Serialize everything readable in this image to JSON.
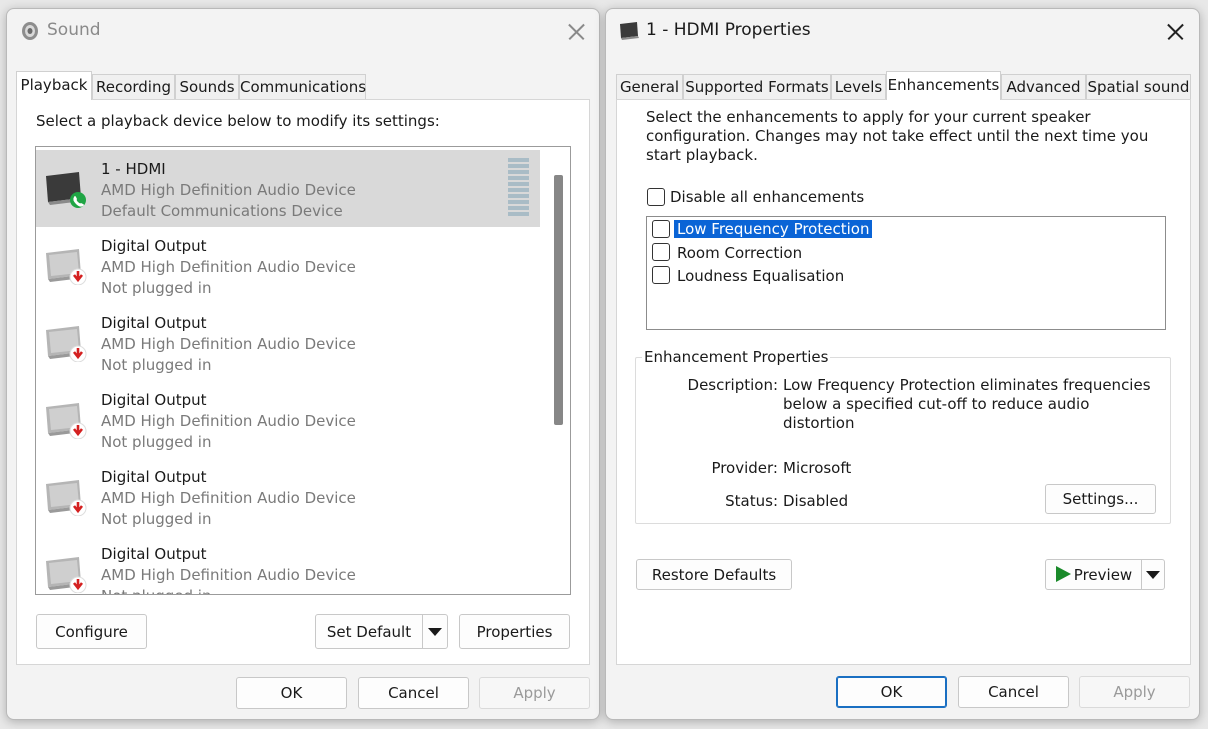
{
  "sound_window": {
    "title": "Sound",
    "tabs": [
      "Playback",
      "Recording",
      "Sounds",
      "Communications"
    ],
    "active_tab": "Playback",
    "instruction": "Select a playback device below to modify its settings:",
    "devices": [
      {
        "name": "1 - HDMI",
        "driver": "AMD High Definition Audio Device",
        "status": "Default Communications Device",
        "badge": "phone",
        "selected": true
      },
      {
        "name": "Digital Output",
        "driver": "AMD High Definition Audio Device",
        "status": "Not plugged in",
        "badge": "unplugged",
        "selected": false
      },
      {
        "name": "Digital Output",
        "driver": "AMD High Definition Audio Device",
        "status": "Not plugged in",
        "badge": "unplugged",
        "selected": false
      },
      {
        "name": "Digital Output",
        "driver": "AMD High Definition Audio Device",
        "status": "Not plugged in",
        "badge": "unplugged",
        "selected": false
      },
      {
        "name": "Digital Output",
        "driver": "AMD High Definition Audio Device",
        "status": "Not plugged in",
        "badge": "unplugged",
        "selected": false
      },
      {
        "name": "Digital Output",
        "driver": "AMD High Definition Audio Device",
        "status": "Not plugged in",
        "badge": "unplugged",
        "selected": false
      }
    ],
    "configure_label": "Configure",
    "set_default_label": "Set Default",
    "properties_label": "Properties",
    "ok_label": "OK",
    "cancel_label": "Cancel",
    "apply_label": "Apply"
  },
  "props_window": {
    "title": "1 - HDMI Properties",
    "tabs": [
      "General",
      "Supported Formats",
      "Levels",
      "Enhancements",
      "Advanced",
      "Spatial sound"
    ],
    "active_tab": "Enhancements",
    "intro": "Select the enhancements to apply for your current speaker configuration. Changes may not take effect until the next time you start playback.",
    "disable_all_label": "Disable all enhancements",
    "disable_all_checked": false,
    "enhancements": [
      {
        "label": "Low Frequency Protection",
        "checked": false,
        "selected": true
      },
      {
        "label": "Room Correction",
        "checked": false,
        "selected": false
      },
      {
        "label": "Loudness Equalisation",
        "checked": false,
        "selected": false
      }
    ],
    "group_label": "Enhancement Properties",
    "description_label": "Description:",
    "description_value": "Low Frequency Protection eliminates frequencies below a specified cut-off to reduce audio distortion",
    "provider_label": "Provider:",
    "provider_value": "Microsoft",
    "status_label": "Status:",
    "status_value": "Disabled",
    "settings_label": "Settings...",
    "restore_label": "Restore Defaults",
    "preview_label": "Preview",
    "ok_label": "OK",
    "cancel_label": "Cancel",
    "apply_label": "Apply"
  },
  "colors": {
    "selection": "#0a64d6",
    "primary_border": "#1a6fc2",
    "phone_badge": "#20a545",
    "unplugged_badge": "#d42020",
    "play_icon": "#1a8a2a"
  }
}
